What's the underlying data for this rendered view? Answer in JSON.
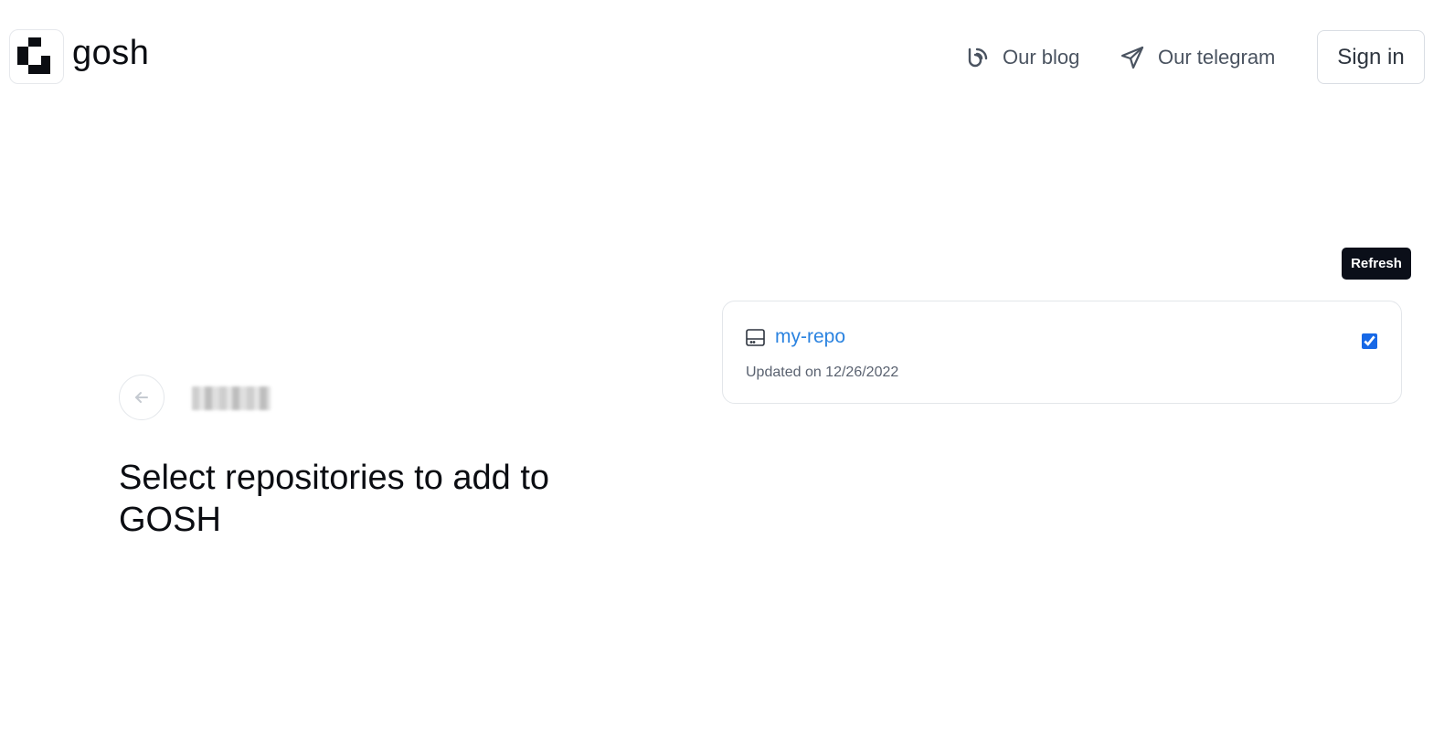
{
  "header": {
    "brand": "gosh",
    "nav": {
      "blog_label": "Our blog",
      "telegram_label": "Our telegram"
    },
    "signin_label": "Sign in"
  },
  "main": {
    "title": "Select repositories to add to GOSH"
  },
  "tooltip": {
    "text": "Refresh"
  },
  "repositories": [
    {
      "name": "my-repo",
      "updated": "Updated on 12/26/2022",
      "selected": true
    }
  ],
  "colors": {
    "link_blue": "#2b83e0",
    "checkbox_blue": "#1768e6",
    "tooltip_bg": "#0b0f19",
    "text_dark": "#0b0d12",
    "text_muted": "#4a5360"
  }
}
